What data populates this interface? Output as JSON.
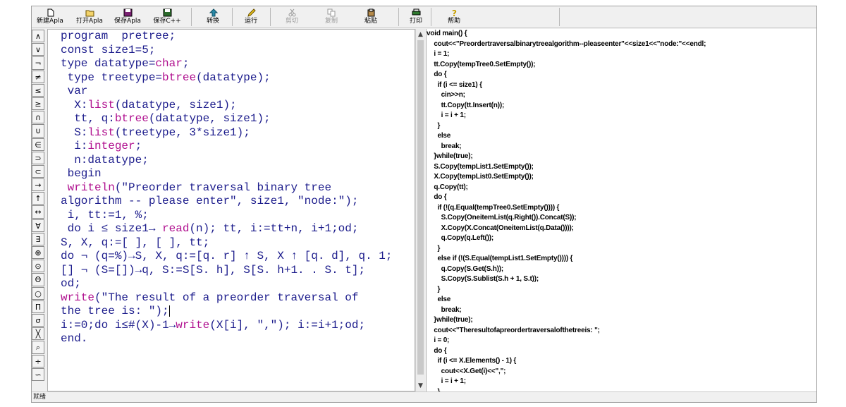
{
  "toolbar": {
    "new_apla": "新建Apla",
    "open_apla": "打开Apla",
    "save_apla": "保存Apla",
    "save_cpp": "保存C++",
    "convert": "转换",
    "run": "运行",
    "cut": "剪切",
    "copy": "复制",
    "paste": "粘贴",
    "print": "打印",
    "help": "帮助"
  },
  "symbols": [
    "∧",
    "∨",
    "¬",
    "≠",
    "≤",
    "≥",
    "∩",
    "∪",
    "∈",
    "⊃",
    "⊂",
    "→",
    "↑",
    "↔",
    "∀",
    "∃",
    "⊕",
    "⊙",
    "Θ",
    "○",
    "Π",
    "σ",
    "╳",
    "⌕",
    "÷",
    "∽"
  ],
  "editor": {
    "lines": [
      [
        {
          "t": "program  pretree;"
        }
      ],
      [
        {
          "t": "const size1=5;"
        }
      ],
      [
        {
          "t": "type datatype="
        },
        {
          "t": "char",
          "k": 1
        },
        {
          "t": ";"
        }
      ],
      [
        {
          "t": " type treetype="
        },
        {
          "t": "btree",
          "k": 1
        },
        {
          "t": "(datatype);"
        }
      ],
      [
        {
          "t": " var"
        }
      ],
      [
        {
          "t": "  X:"
        },
        {
          "t": "list",
          "k": 1
        },
        {
          "t": "(datatype, size1);"
        }
      ],
      [
        {
          "t": "  tt, q:"
        },
        {
          "t": "btree",
          "k": 1
        },
        {
          "t": "(datatype, size1);"
        }
      ],
      [
        {
          "t": "  S:"
        },
        {
          "t": "list",
          "k": 1
        },
        {
          "t": "(treetype, 3*size1);"
        }
      ],
      [
        {
          "t": "  i:"
        },
        {
          "t": "integer",
          "k": 1
        },
        {
          "t": ";"
        }
      ],
      [
        {
          "t": "  n:datatype;"
        }
      ],
      [
        {
          "t": " begin"
        }
      ],
      [
        {
          "t": " writeln",
          "k": 1
        },
        {
          "t": "(\"Preorder traversal binary tree"
        }
      ],
      [
        {
          "t": "algorithm -- please enter\", size1, \"node:\");"
        }
      ],
      [
        {
          "t": " i, tt:=1, %;"
        }
      ],
      [
        {
          "t": " do i ≤ size1→ "
        },
        {
          "t": "read",
          "k": 1
        },
        {
          "t": "(n); tt, i:=tt+n, i+1;od;"
        }
      ],
      [
        {
          "t": "S, X, q:=[ ], [ ], tt;"
        }
      ],
      [
        {
          "t": "do ¬ (q=%)→S, X, q:=[q. r] ↑ S, X ↑ [q. d], q. 1;"
        }
      ],
      [
        {
          "t": "[] ¬ (S=[])→q, S:=S[S. h], S[S. h+1. . S. t];"
        }
      ],
      [
        {
          "t": "od;"
        }
      ],
      [
        {
          "t": "write",
          "k": 1
        },
        {
          "t": "(\"The result of a preorder traversal of"
        }
      ],
      [
        {
          "t": "the tree is: \");",
          "c": 1
        }
      ],
      [
        {
          "t": "i:=0;do i≤#(X)-1→"
        },
        {
          "t": "write",
          "k": 1
        },
        {
          "t": "(X[i], \",\"); i:=i+1;od;"
        }
      ],
      [
        {
          "t": "end."
        }
      ]
    ]
  },
  "output": {
    "lines": [
      "void main() {",
      "    cout<<\"Preordertraversalbinarytreealgorithm--pleaseenter\"<<size1<<\"node:\"<<endl;",
      "    i = 1;",
      "    tt.Copy(tempTree0.SetEmpty());",
      "    do {",
      "      if (i <= size1) {",
      "        cin>>n;",
      "        tt.Copy(tt.Insert(n));",
      "        i = i + 1;",
      "      }",
      "      else",
      "        break;",
      "    }while(true);",
      "    S.Copy(tempList1.SetEmpty());",
      "    X.Copy(tempList0.SetEmpty());",
      "    q.Copy(tt);",
      "    do {",
      "      if (!(q.Equal(tempTree0.SetEmpty()))) {",
      "        S.Copy(OneitemList(q.Right()).Concat(S));",
      "        X.Copy(X.Concat(OneitemList(q.Data())));",
      "        q.Copy(q.Left());",
      "      }",
      "      else if (!(S.Equal(tempList1.SetEmpty()))) {",
      "        q.Copy(S.Get(S.h));",
      "        S.Copy(S.Sublist(S.h + 1, S.t));",
      "      }",
      "      else",
      "        break;",
      "    }while(true);",
      "    cout<<\"Theresultofapreordertraversalofthetreeis: \";",
      "    i = 0;",
      "    do {",
      "      if (i <= X.Elements() - 1) {",
      "        cout<<X.Get(i)<<\",\";",
      "        i = i + 1;",
      "      }"
    ]
  },
  "status": "就绪",
  "colors": {
    "keyword": "#b0108f",
    "code": "#1c1c8c"
  }
}
